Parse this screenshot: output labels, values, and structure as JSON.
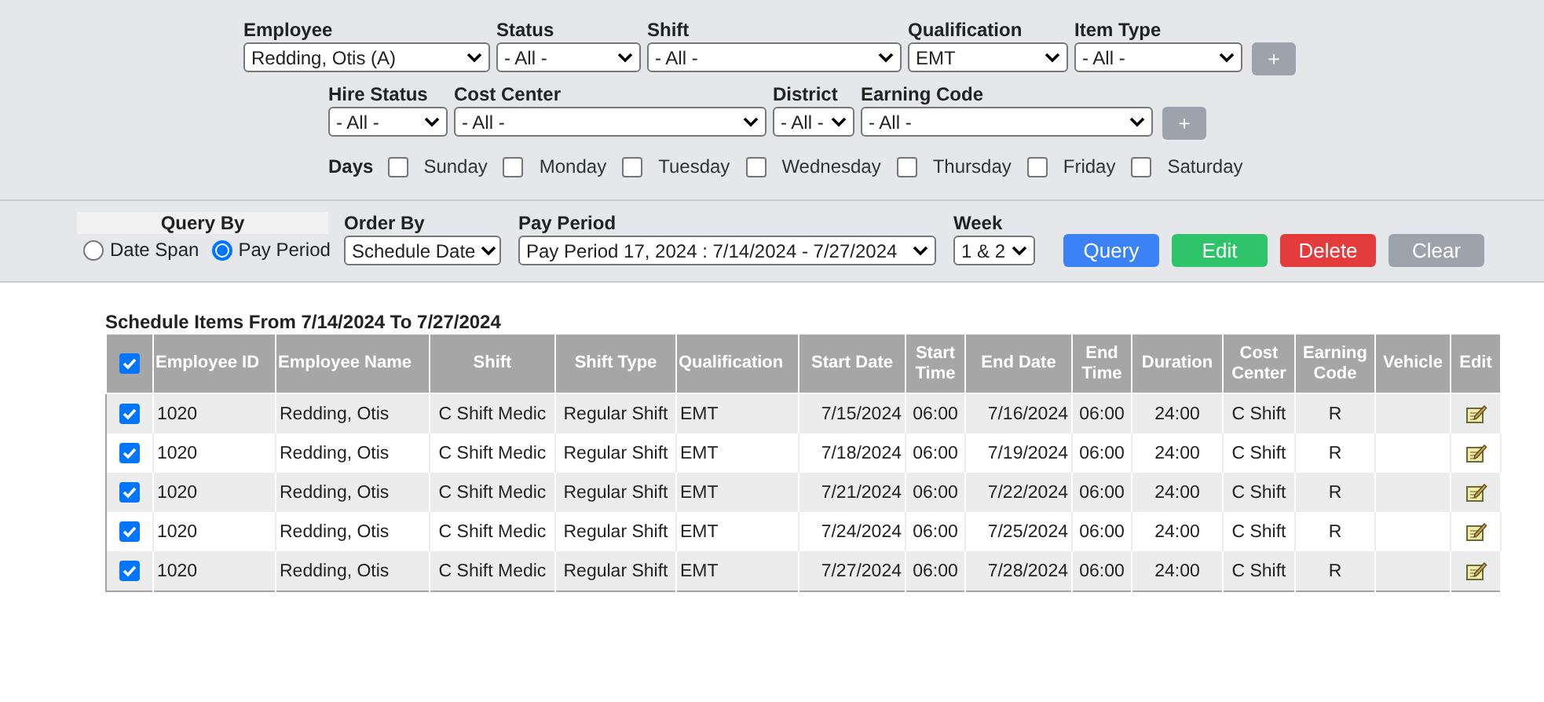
{
  "filters": {
    "rows": [
      {
        "fields": [
          {
            "label": "Employee",
            "value": "Redding, Otis (A)"
          },
          {
            "label": "Status",
            "value": "- All -"
          },
          {
            "label": "Shift",
            "value": "- All -"
          },
          {
            "label": "Qualification",
            "value": "EMT"
          },
          {
            "label": "Item Type",
            "value": "- All -"
          }
        ],
        "add_button": "+"
      },
      {
        "fields": [
          {
            "label": "Hire Status",
            "value": "- All -"
          },
          {
            "label": "Cost Center",
            "value": "- All -"
          },
          {
            "label": "District",
            "value": "- All -"
          },
          {
            "label": "Earning Code",
            "value": "- All -"
          }
        ],
        "add_button": "+"
      }
    ],
    "days": {
      "label": "Days",
      "items": [
        {
          "label": "Sunday",
          "checked": false
        },
        {
          "label": "Monday",
          "checked": false
        },
        {
          "label": "Tuesday",
          "checked": false
        },
        {
          "label": "Wednesday",
          "checked": false
        },
        {
          "label": "Thursday",
          "checked": false
        },
        {
          "label": "Friday",
          "checked": false
        },
        {
          "label": "Saturday",
          "checked": false
        }
      ]
    }
  },
  "query_bar": {
    "query_by": {
      "label": "Query By",
      "options": [
        {
          "label": "Date Span",
          "selected": false
        },
        {
          "label": "Pay Period",
          "selected": true
        }
      ]
    },
    "order_by": {
      "label": "Order By",
      "value": "Schedule Date"
    },
    "pay_period": {
      "label": "Pay Period",
      "value": "Pay Period 17, 2024 : 7/14/2024 - 7/27/2024"
    },
    "week": {
      "label": "Week",
      "value": "1 & 2"
    },
    "buttons": [
      {
        "label": "Query",
        "kind": "primary"
      },
      {
        "label": "Edit",
        "kind": "success"
      },
      {
        "label": "Delete",
        "kind": "danger"
      },
      {
        "label": "Clear",
        "kind": "secondary"
      }
    ]
  },
  "table": {
    "title": "Schedule Items From 7/14/2024 To 7/27/2024",
    "all_checked": true,
    "columns": [
      "Employee ID",
      "Employee Name",
      "Shift",
      "Shift Type",
      "Qualification",
      "Start Date",
      "Start Time",
      "End Date",
      "End Time",
      "Duration",
      "Cost Center",
      "Earning Code",
      "Vehicle",
      "Edit"
    ],
    "rows": [
      {
        "checked": true,
        "cells": [
          "1020",
          "Redding, Otis",
          "C Shift Medic",
          "Regular Shift",
          "EMT",
          "7/15/2024",
          "06:00",
          "7/16/2024",
          "06:00",
          "24:00",
          "C Shift",
          "R"
        ]
      },
      {
        "checked": true,
        "cells": [
          "1020",
          "Redding, Otis",
          "C Shift Medic",
          "Regular Shift",
          "EMT",
          "7/18/2024",
          "06:00",
          "7/19/2024",
          "06:00",
          "24:00",
          "C Shift",
          "R"
        ]
      },
      {
        "checked": true,
        "cells": [
          "1020",
          "Redding, Otis",
          "C Shift Medic",
          "Regular Shift",
          "EMT",
          "7/21/2024",
          "06:00",
          "7/22/2024",
          "06:00",
          "24:00",
          "C Shift",
          "R"
        ]
      },
      {
        "checked": true,
        "cells": [
          "1020",
          "Redding, Otis",
          "C Shift Medic",
          "Regular Shift",
          "EMT",
          "7/24/2024",
          "06:00",
          "7/25/2024",
          "06:00",
          "24:00",
          "C Shift",
          "R"
        ]
      },
      {
        "checked": true,
        "cells": [
          "1020",
          "Redding, Otis",
          "C Shift Medic",
          "Regular Shift",
          "EMT",
          "7/27/2024",
          "06:00",
          "7/28/2024",
          "06:00",
          "24:00",
          "C Shift",
          "R"
        ]
      }
    ]
  }
}
